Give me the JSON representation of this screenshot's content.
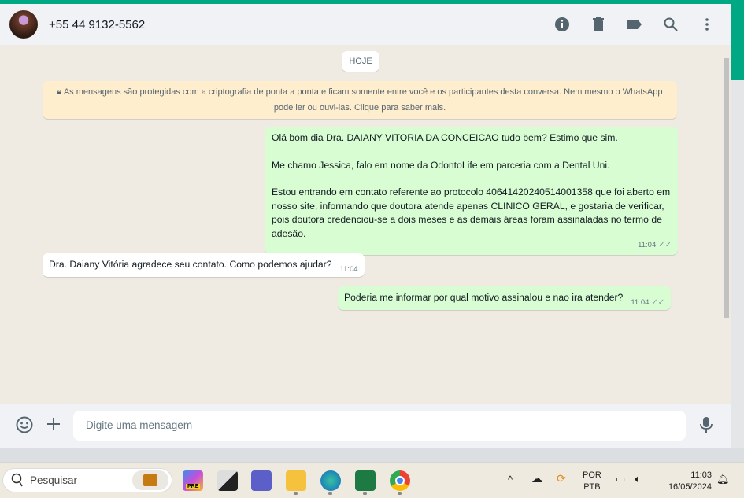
{
  "header": {
    "contact": "+55 44 9132-5562"
  },
  "chat": {
    "date_label": "HOJE",
    "encryption_notice": "As mensagens são protegidas com a criptografia de ponta a ponta e ficam somente entre você e os participantes desta conversa. Nem mesmo o WhatsApp pode ler ou ouvi-las. Clique para saber mais.",
    "messages": [
      {
        "dir": "out",
        "lines": [
          "Olá bom dia Dra. DAIANY VITORIA DA CONCEICAO tudo bem? Estimo que sim.",
          "Me chamo Jessica, falo em nome da OdontoLife em parceria com a Dental Uni.",
          "Estou entrando em contato referente ao protocolo 40641420240514001358 que foi aberto em nosso site, informando que doutora atende apenas CLINICO GERAL, e gostaria de verificar, pois doutora credenciou-se a dois meses e as demais áreas foram assinaladas no termo de adesão."
        ],
        "time": "11:04"
      },
      {
        "dir": "in",
        "text": "Dra. Daiany Vitória agradece seu contato. Como podemos ajudar?",
        "time": "11:04"
      },
      {
        "dir": "out",
        "text": "Poderia me informar por qual motivo assinalou e nao ira atender?",
        "time": "11:04"
      }
    ]
  },
  "composer": {
    "placeholder": "Digite uma mensagem"
  },
  "taskbar": {
    "search": "Pesquisar",
    "lang1": "POR",
    "lang2": "PTB",
    "time": "11:03",
    "date": "16/05/2024",
    "copilot_badge": "PRE"
  }
}
